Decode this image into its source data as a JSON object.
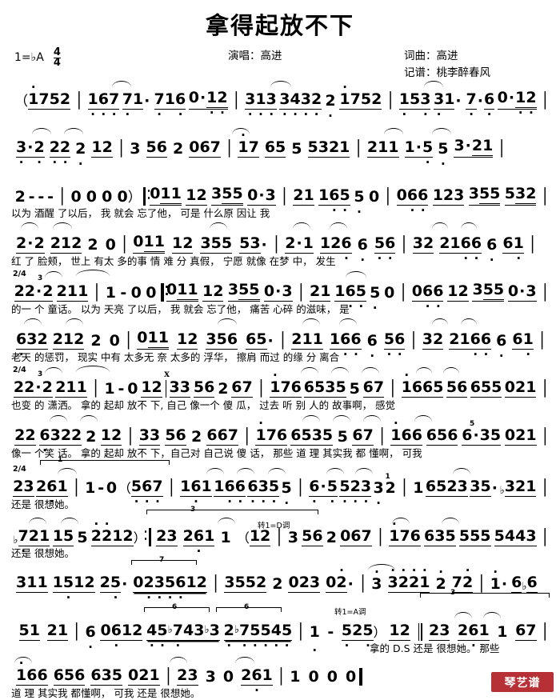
{
  "header": {
    "title": "拿得起放不下",
    "key_signature": "1=♭A",
    "time_signature": {
      "numerator": "4",
      "denominator": "4"
    },
    "singer_label": "演唱：高进",
    "writer_label": "词曲：高进",
    "scribe_label": "记谱：桃李醉春风"
  },
  "watermark": {
    "text": "琴艺谱"
  },
  "annotations": {
    "meter_2_4": "2/4",
    "triplet_3": "3",
    "septuplet_7": "7",
    "sextuplet_6": "6",
    "bracket_1": "1",
    "bracket_3": "3",
    "modulate_d": "转1=D调",
    "modulate_a": "转1=A调",
    "ds_mark": "D.S"
  },
  "staff_lines": [
    {
      "id": "line-1",
      "notes": "（1752 | 167 71· 716 0·12 | 313 3432 2 1752 | 153 31· 7·6 0·12 |",
      "lyrics": ""
    },
    {
      "id": "line-2",
      "notes": "3·2 22 2 12 | 3 56 2 067 | 17 65 5 5321 | 211 1·5 5 3·21 |",
      "lyrics": ""
    },
    {
      "id": "line-3",
      "notes": "2 - - - | 0 0 0 0） 011 12 355 0·3 | 21 165 5 0 | 066 123 355 532 |",
      "lyrics": "以为 酒醒 了以后， 我   就会 忘了他，      可是 什么原  因让  我"
    },
    {
      "id": "line-4",
      "notes": "2·2 212 2 0 | 011 12 355 53· | 2·1 126 6 56 | 32 2166 6 61 |",
      "lyrics": "红 了  脸颊，     世上 有太 多的事  情   难 分  真假，  宁愿  就像 在梦 中， 发生"
    },
    {
      "id": "line-5",
      "notes": "22·2 211 | 1 - 0 0 ‖: 011 12 355 0·3 | 21 165 5 0 | 066 12 355 0·3 |",
      "lyrics": "的一 个  童话。        以为 天亮 了以后， 我   就会 忘了他，    痛苦 心碎 的滋味，  是"
    },
    {
      "id": "line-6",
      "notes": "632 212 2 0 | 011 12 356 65· | 211 166 6 56 | 32 2166 6 61 |",
      "lyrics": "老天  的惩罚，    现实 中有 太多无  奈   太多的  浮华，  擦肩  而过 的缘 分   离合"
    },
    {
      "id": "line-7",
      "notes": "22·2 211 | 1 - 0 12 | 33 56 2 67 | 176 6535 5 67 | 1665 56 655 021 |",
      "lyrics": "也变 的  潇洒。     拿的   起却 放不 下, 自己  像一个  傻 瓜， 过去  听 别  人的 故事啊， 感觉"
    },
    {
      "id": "line-8",
      "notes": "22 6322 2 12 | 33 56 2 667 | 176 6535 5 67 | 166 656 6·35 021 |",
      "lyrics": "像一 个笑 话。  拿的   起却 放不 下，自己对  自己说  傻 话，  那些  道 理 其实我 都 懂啊， 可我"
    },
    {
      "id": "line-9",
      "notes": "23 261 | 1 - 0 （567 | 161 166 635 5 | 6·5 523 3 2 | 1 6523 35· ♭321 |",
      "lyrics": "还是 很想她。"
    },
    {
      "id": "line-10",
      "notes": "♭721 15 5 2212）:‖ 23 261 1 （12 | 3 56 2 067 | 176 635 555 5443 |",
      "lyrics": "还是  很想她。"
    },
    {
      "id": "line-11",
      "notes": "311 1512 25· 0235612 | 3552 2 023 02· | 3 3221 2 72 | 1 · 6♭6",
      "lyrics": ""
    },
    {
      "id": "line-12",
      "notes": "51 21 | 6 0612 45♭743♭3 2♭75545 | 1 - 525） 12 ‖ 23 261 1 67 |",
      "lyrics": "拿的 D.S 还是  很想她。    那些"
    },
    {
      "id": "line-13",
      "notes": "166 656 635 021 | 23 3 0 261 | 1 0 0 0 ‖",
      "lyrics": "道 理 其实我 都懂啊， 可我   还是    很想她。"
    }
  ]
}
